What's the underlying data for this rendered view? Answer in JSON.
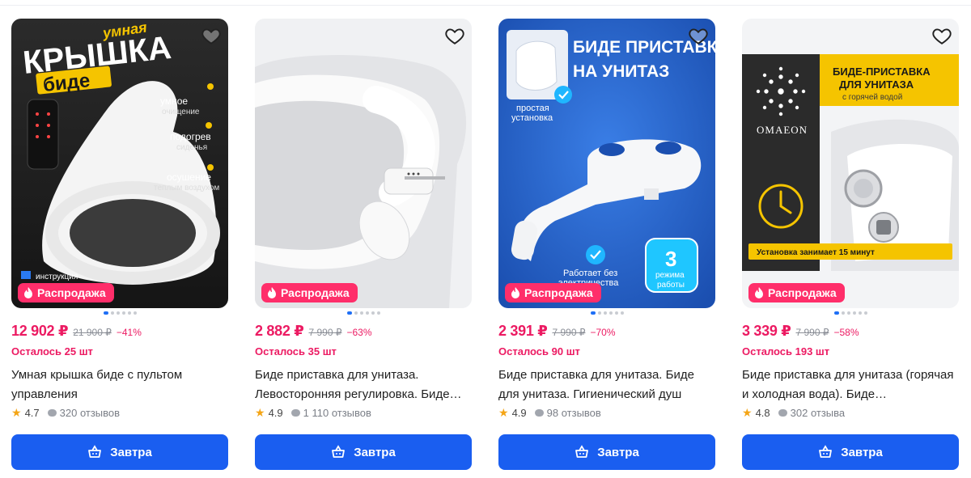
{
  "products": [
    {
      "badge": "Распродажа",
      "price": "12 902 ₽",
      "old_price": "21 900 ₽",
      "discount": "−41%",
      "stock": "Осталось 25 шт",
      "title": "Умная крышка биде с пультом управления",
      "rating": "4.7",
      "reviews": "320 отзывов",
      "delivery": "Завтра",
      "image_text": {
        "line1": "умная",
        "line2": "КРЫШКА",
        "line3": "биде",
        "f1": "умное",
        "f1b": "очищение",
        "f2": "подогрев",
        "f2b": "сиденья",
        "f3": "осушение",
        "f3b": "теплым воздухом",
        "f4": "инструкция"
      }
    },
    {
      "badge": "Распродажа",
      "price": "2 882 ₽",
      "old_price": "7 990 ₽",
      "discount": "−63%",
      "stock": "Осталось 35 шт",
      "title": "Биде приставка для унитаза. Левосторонняя регулировка. Биде…",
      "rating": "4.9",
      "reviews": "1 110 отзывов",
      "delivery": "Завтра"
    },
    {
      "badge": "Распродажа",
      "price": "2 391 ₽",
      "old_price": "7 990 ₽",
      "discount": "−70%",
      "stock": "Осталось 90 шт",
      "title": "Биде приставка для унитаза. Биде для унитаза. Гигиенический душ",
      "rating": "4.9",
      "reviews": "98 отзывов",
      "delivery": "Завтра",
      "image_text": {
        "h1": "БИДЕ ПРИСТАВКА",
        "h2": "НА УНИТАЗ",
        "easy1": "простая",
        "easy2": "установка",
        "works1": "Работает без",
        "works2": "электричества",
        "modes_num": "3",
        "modes1": "режима",
        "modes2": "работы"
      }
    },
    {
      "badge": "Распродажа",
      "price": "3 339 ₽",
      "old_price": "7 990 ₽",
      "discount": "−58%",
      "stock": "Осталось 193 шт",
      "title": "Биде приставка для унитаза (горячая и холодная вода). Биде…",
      "rating": "4.8",
      "reviews": "302 отзыва",
      "delivery": "Завтра",
      "image_text": {
        "brand": "OMAEON",
        "h1": "БИДЕ-ПРИСТАВКА",
        "h2": "ДЛЯ УНИТАЗА",
        "h3": "с горячей водой",
        "install": "Установка занимает 15 минут"
      }
    }
  ],
  "colors": {
    "accent": "#1a5ef0",
    "sale": "#ff2e6a",
    "price": "#ec1a62",
    "star": "#f4a516"
  },
  "icons": [
    "heart-icon",
    "flame-icon",
    "star-icon",
    "chat-bubble-icon",
    "basket-icon"
  ]
}
